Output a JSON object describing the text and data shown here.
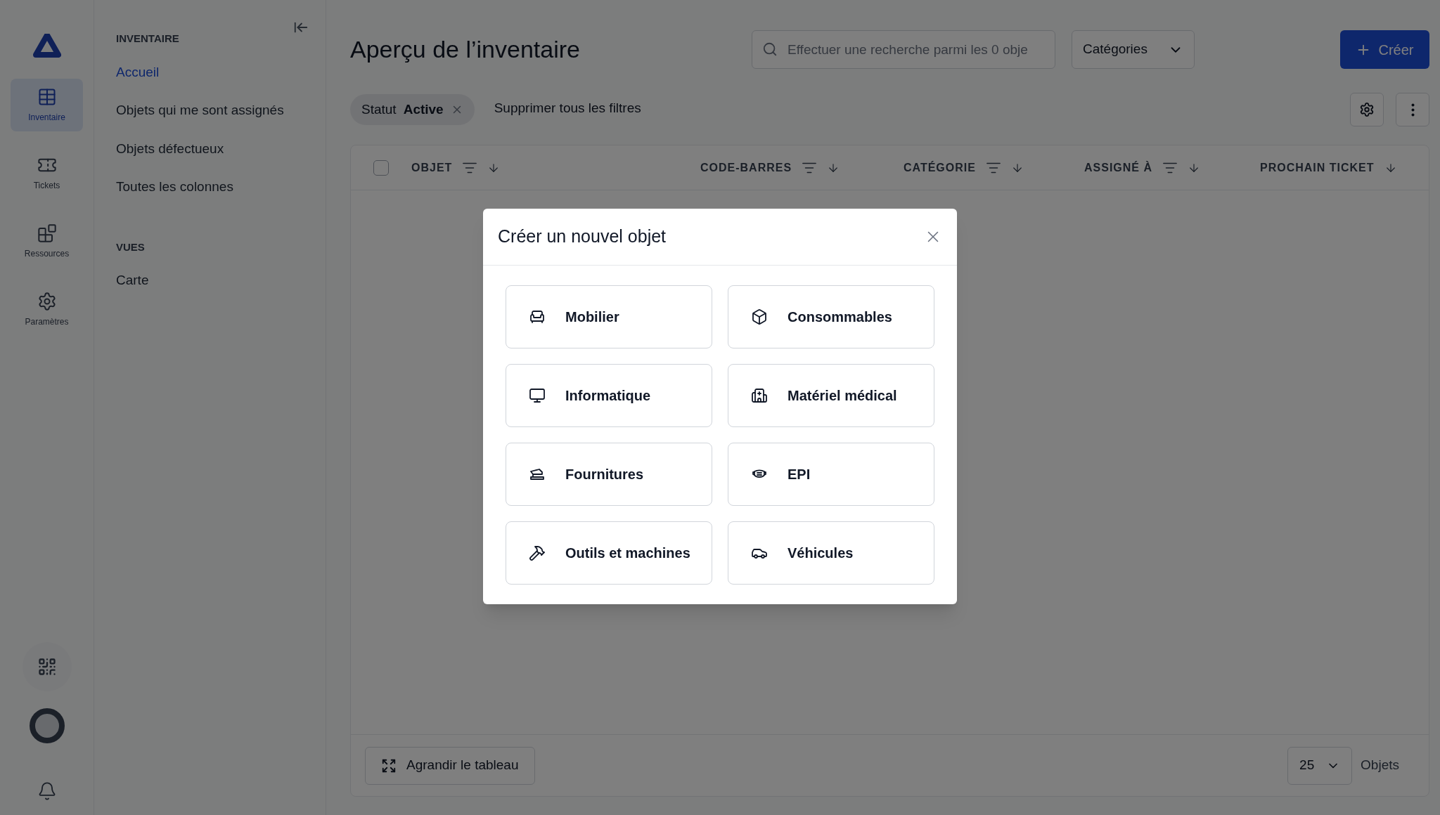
{
  "rail": {
    "items": [
      {
        "kind": "table",
        "label": "Inventaire",
        "selected": true
      },
      {
        "kind": "ticket",
        "label": "Tickets",
        "selected": false
      },
      {
        "kind": "blocks",
        "label": "Ressources",
        "selected": false
      },
      {
        "kind": "gear",
        "label": "Paramètres",
        "selected": false
      }
    ]
  },
  "nav": {
    "sections": [
      {
        "title": "INVENTAIRE",
        "items": [
          {
            "label": "Accueil",
            "selected": true
          },
          {
            "label": "Objets qui me sont assignés",
            "selected": false
          },
          {
            "label": "Objets défectueux",
            "selected": false
          },
          {
            "label": "Toutes les colonnes",
            "selected": false
          }
        ]
      },
      {
        "title": "VUES",
        "items": [
          {
            "label": "Carte",
            "selected": false
          }
        ]
      }
    ]
  },
  "header": {
    "title": "Aperçu de l’inventaire",
    "search": {
      "placeholder": "Effectuer une recherche parmi les 0 obje"
    },
    "categories": "Catégories",
    "create": "Créer"
  },
  "filters": {
    "chips": [
      {
        "label": "Statut",
        "value": "Active"
      }
    ],
    "clear": "Supprimer tous les filtres"
  },
  "table": {
    "select_all_checked": false,
    "columns": [
      {
        "label": "OBJET",
        "filter": true
      },
      {
        "label": "CODE-BARRES",
        "filter": true
      },
      {
        "label": "CATÉGORIE",
        "filter": true
      },
      {
        "label": "ASSIGNÉ À",
        "filter": true
      },
      {
        "label": "PROCHAIN TICKET",
        "filter": false
      }
    ]
  },
  "footer": {
    "expand": "Agrandir le tableau",
    "page_size": "25",
    "unit": "Objets"
  },
  "modal": {
    "title": "Créer un nouvel objet",
    "options": [
      {
        "kind": "chair",
        "label": "Mobilier"
      },
      {
        "kind": "box",
        "label": "Consommables"
      },
      {
        "kind": "monitor",
        "label": "Informatique"
      },
      {
        "kind": "medical",
        "label": "Matériel médical"
      },
      {
        "kind": "stapler",
        "label": "Fournitures"
      },
      {
        "kind": "mask",
        "label": "EPI"
      },
      {
        "kind": "hammer",
        "label": "Outils et machines"
      },
      {
        "kind": "car",
        "label": "Véhicules"
      }
    ]
  }
}
